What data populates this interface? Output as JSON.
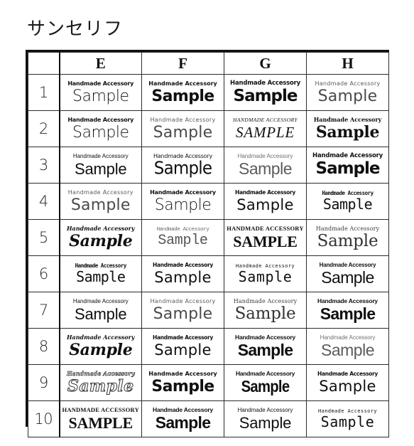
{
  "title": "サンセリフ",
  "table": {
    "row_header_blank": "",
    "columns": [
      "E",
      "F",
      "G",
      "H"
    ],
    "row_numbers": [
      "1",
      "2",
      "3",
      "4",
      "5",
      "6",
      "7",
      "8",
      "9",
      "10"
    ],
    "caption_default": "Handmade Accessory",
    "sample_default": "Sample",
    "rows": [
      {
        "number": "1",
        "cells": [
          {
            "caption": "Handmade Accessory",
            "sample": "Sample",
            "style": "f-geo"
          },
          {
            "caption": "Handmade Accessory",
            "sample": "Sample",
            "style": "f-geo-bold"
          },
          {
            "caption": "Handmade Accessory",
            "sample": "Sample",
            "style": "f-round"
          },
          {
            "caption": "Handmade Accessory",
            "sample": "Sample",
            "style": "f-thin"
          }
        ]
      },
      {
        "number": "2",
        "cells": [
          {
            "caption": "Handmade Accessory",
            "sample": "Sample",
            "style": "f-geo"
          },
          {
            "caption": "Handmade Accessory",
            "sample": "Sample",
            "style": "f-thin"
          },
          {
            "caption": "HANDMADE ACCESSORY",
            "sample": "SAMPLE",
            "style": "f-italcaps"
          },
          {
            "caption": "Handmade Accessory",
            "sample": "Sample",
            "style": "f-slab"
          }
        ]
      },
      {
        "number": "3",
        "cells": [
          {
            "caption": "Handmade Accessory",
            "sample": "Sample",
            "style": "f-lightnar"
          },
          {
            "caption": "Handmade Accessory",
            "sample": "Sample",
            "style": "f-tall"
          },
          {
            "caption": "Handmade Accessory",
            "sample": "Sample",
            "style": "f-grot-light"
          },
          {
            "caption": "Handmade Accessory",
            "sample": "Sample",
            "style": "f-round"
          }
        ]
      },
      {
        "number": "4",
        "cells": [
          {
            "caption": "Handmade Accessory",
            "sample": "Sample",
            "style": "f-thin"
          },
          {
            "caption": "Handmade Accessory",
            "sample": "Sample",
            "style": "f-geo"
          },
          {
            "caption": "Handmade Accessory",
            "sample": "Sample",
            "style": "f-hand"
          },
          {
            "caption": "Handmade Accessory",
            "sample": "Sample",
            "style": "f-mono"
          }
        ]
      },
      {
        "number": "5",
        "cells": [
          {
            "caption": "Handmade Accessory",
            "sample": "Sample",
            "style": "f-scriptb"
          },
          {
            "caption": "Handmade Accessory",
            "sample": "Sample",
            "style": "f-mono-light"
          },
          {
            "caption": "HANDMADE ACCESSORY",
            "sample": "SAMPLE",
            "style": "f-smallcaps"
          },
          {
            "caption": "Handmade Accessory",
            "sample": "Sample",
            "style": "f-calli"
          }
        ]
      },
      {
        "number": "6",
        "cells": [
          {
            "caption": "Handmade Accessory",
            "sample": "Sample",
            "style": "f-mono"
          },
          {
            "caption": "Handmade Accessory",
            "sample": "Sample",
            "style": "f-hand"
          },
          {
            "caption": "Handmade Accessory",
            "sample": "Sample",
            "style": "f-mono-wide"
          },
          {
            "caption": "Handmade Accessory",
            "sample": "Sample",
            "style": "f-grot"
          }
        ]
      },
      {
        "number": "7",
        "cells": [
          {
            "caption": "Handmade Accessory",
            "sample": "Sample",
            "style": "f-lightnar"
          },
          {
            "caption": "Handmade Accessory",
            "sample": "Sample",
            "style": "f-thin"
          },
          {
            "caption": "Handmade Accessory",
            "sample": "Sample",
            "style": "f-calli"
          },
          {
            "caption": "Handmade Accessory",
            "sample": "Sample",
            "style": "f-grot-bold"
          }
        ]
      },
      {
        "number": "8",
        "cells": [
          {
            "caption": "Handmade Accessory",
            "sample": "Sample",
            "style": "f-scriptb"
          },
          {
            "caption": "Handmade Accessory",
            "sample": "Sample",
            "style": "f-hand"
          },
          {
            "caption": "Handmade Accessory",
            "sample": "Sample",
            "style": "f-grot-bold"
          },
          {
            "caption": "Handmade Accessory",
            "sample": "Sample",
            "style": "f-grot-light"
          }
        ]
      },
      {
        "number": "9",
        "cells": [
          {
            "caption": "Handmade Accessory",
            "sample": "Sample",
            "style": "f-outline"
          },
          {
            "caption": "Handmade Accessory",
            "sample": "Sample",
            "style": "f-geo-bold"
          },
          {
            "caption": "Handmade Accessory",
            "sample": "Sample",
            "style": "f-cond"
          },
          {
            "caption": "Handmade Accessory",
            "sample": "Sample",
            "style": "f-hand"
          }
        ]
      },
      {
        "number": "10",
        "cells": [
          {
            "caption": "HANDMADE ACCESSORY",
            "sample": "SAMPLE",
            "style": "f-smallcaps"
          },
          {
            "caption": "Handmade Accessory",
            "sample": "Sample",
            "style": "f-grot-bold"
          },
          {
            "caption": "Handmade Accessory",
            "sample": "Sample",
            "style": "f-lightnar"
          },
          {
            "caption": "Handmade Accessory",
            "sample": "Sample",
            "style": "f-mono-wide"
          }
        ]
      }
    ]
  },
  "colors": {
    "background": "#ffffff",
    "text": "#101010",
    "border_outer": "#111111",
    "border_inner": "#2b2b2b",
    "muted_text": "#5a5a5a"
  }
}
